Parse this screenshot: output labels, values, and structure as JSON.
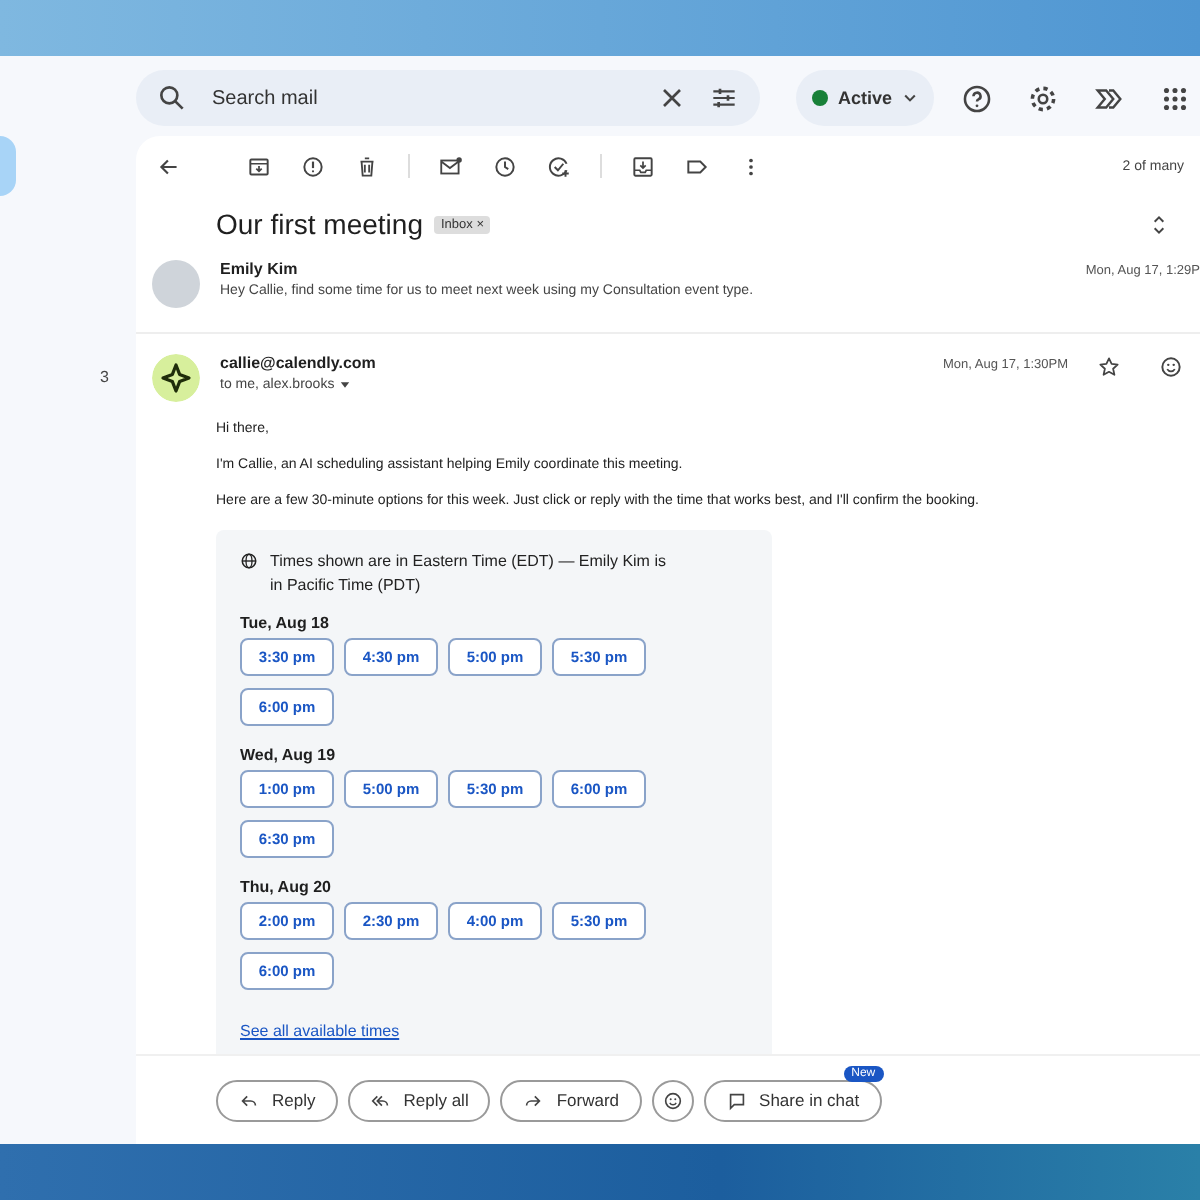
{
  "search": {
    "placeholder": "Search mail"
  },
  "status": {
    "label": "Active",
    "color": "#188038"
  },
  "sidebar": {
    "count": "3"
  },
  "toolbar": {
    "pager": "2 of many"
  },
  "thread": {
    "subject": "Our first meeting",
    "label": "Inbox",
    "label_close": "×"
  },
  "messages": [
    {
      "kind": "collapsed",
      "sender": "Emily Kim",
      "snippet": "Hey Callie, find some time for us to meet next week using my Consultation event type.",
      "date": "Mon, Aug 17, 1:29P"
    },
    {
      "kind": "open",
      "sender": "callie@calendly.com",
      "to": "to me, alex.brooks",
      "date": "Mon, Aug 17, 1:30PM"
    }
  ],
  "body": {
    "paragraphs": [
      "Hi there,",
      "I'm Callie, an AI scheduling assistant helping Emily coordinate this meeting.",
      "Here are a few 30-minute options for this week. Just click or reply with the time that works best, and I'll confirm the booking."
    ],
    "timezone_note": "Times shown are in Eastern Time (EDT) — Emily Kim is in Pacific Time (PDT)",
    "days": [
      {
        "day": "Tue, Aug 18",
        "slots": [
          "3:30 pm",
          "4:30 pm",
          "5:00 pm",
          "5:30 pm",
          "6:00 pm"
        ]
      },
      {
        "day": "Wed, Aug 19",
        "slots": [
          "1:00 pm",
          "5:00 pm",
          "5:30 pm",
          "6:00 pm",
          "6:30 pm"
        ]
      },
      {
        "day": "Thu, Aug 20",
        "slots": [
          "2:00 pm",
          "2:30 pm",
          "4:00 pm",
          "5:30 pm",
          "6:00 pm"
        ]
      }
    ],
    "see_all": "See all available times"
  },
  "actions": [
    {
      "kind": "reply",
      "label": "Reply"
    },
    {
      "kind": "reply_all",
      "label": "Reply all"
    },
    {
      "kind": "forward",
      "label": "Forward"
    },
    {
      "kind": "emoji"
    },
    {
      "kind": "chat",
      "label": "Share in chat",
      "badge": "New"
    }
  ]
}
